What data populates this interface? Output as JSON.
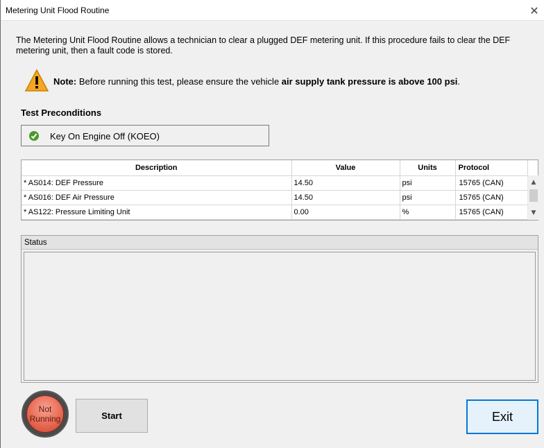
{
  "window": {
    "title": "Metering Unit Flood Routine",
    "close_glyph": "✕"
  },
  "intro": {
    "text": "The Metering Unit Flood Routine allows a technician to clear a plugged DEF metering unit. If this procedure fails to clear the DEF metering unit, then a fault code is stored."
  },
  "note": {
    "icon": "warning-icon",
    "label": "Note:",
    "text_before": " Before running this test, please ensure the vehicle ",
    "emphasis": "air supply tank pressure is above 100 psi",
    "text_after": "."
  },
  "preconditions": {
    "title": "Test Preconditions",
    "items": [
      {
        "icon": "check-circle-icon",
        "label": "Key On Engine Off (KOEO)"
      }
    ]
  },
  "grid": {
    "columns": [
      "Description",
      "Value",
      "Units",
      "Protocol"
    ],
    "rows": [
      {
        "description": "* AS014: DEF Pressure",
        "value": "14.50",
        "units": "psi",
        "protocol": "15765 (CAN)"
      },
      {
        "description": "* AS016: DEF Air Pressure",
        "value": "14.50",
        "units": "psi",
        "protocol": "15765 (CAN)"
      },
      {
        "description": "* AS122: Pressure Limiting Unit",
        "value": "0.00",
        "units": "%",
        "protocol": "15765 (CAN)"
      }
    ]
  },
  "status": {
    "label": "Status"
  },
  "indicator": {
    "line1": "Not",
    "line2": "Running",
    "color": "#e86a55"
  },
  "buttons": {
    "start": "Start",
    "exit": "Exit"
  },
  "colors": {
    "accent": "#0078d7",
    "warning": "#f5a623",
    "ok": "#4a9a2a"
  }
}
